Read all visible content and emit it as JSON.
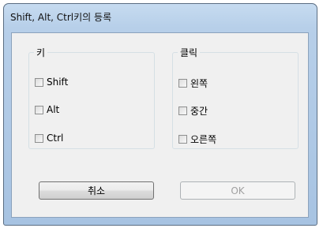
{
  "window": {
    "title": "Shift, Alt, Ctrl키의 등록"
  },
  "key_group": {
    "legend": "키",
    "items": [
      {
        "label": "Shift",
        "checked": false
      },
      {
        "label": "Alt",
        "checked": false
      },
      {
        "label": "Ctrl",
        "checked": false
      }
    ]
  },
  "click_group": {
    "legend": "클릭",
    "items": [
      {
        "label": "왼쪽",
        "checked": false
      },
      {
        "label": "중간",
        "checked": false
      },
      {
        "label": "오른쪽",
        "checked": false
      }
    ]
  },
  "buttons": {
    "cancel_label": "취소",
    "ok_label": "OK",
    "ok_enabled": false
  }
}
